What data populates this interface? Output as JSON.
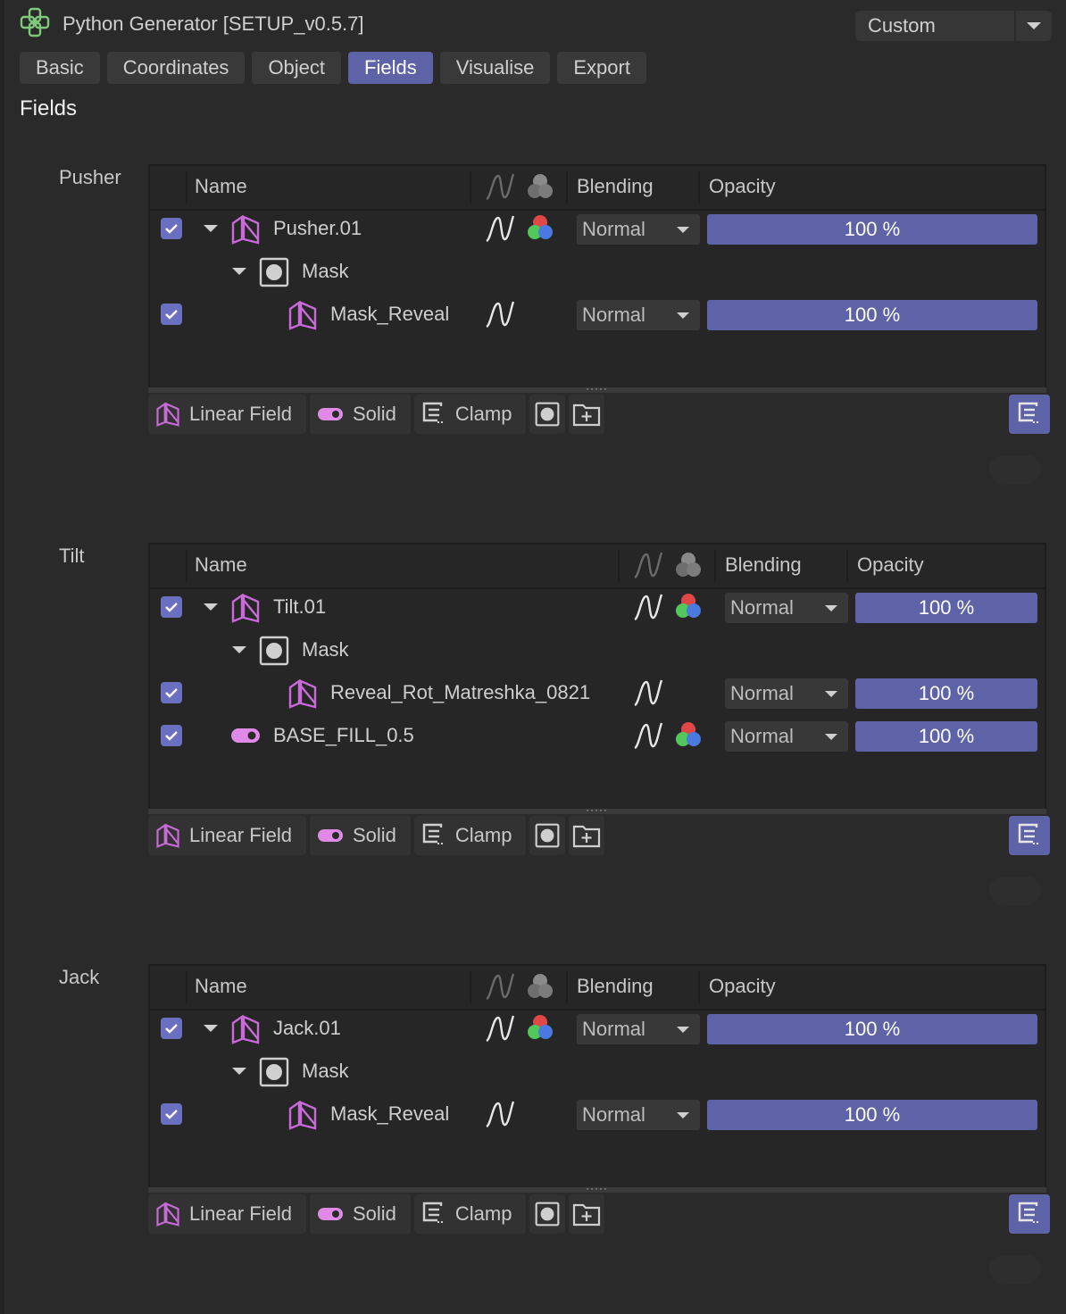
{
  "header": {
    "title": "Python Generator [SETUP_v0.5.7]",
    "preset": "Custom"
  },
  "tabs": [
    "Basic",
    "Coordinates",
    "Object",
    "Fields",
    "Visualise",
    "Export"
  ],
  "active_tab": "Fields",
  "section_title": "Fields",
  "columns": {
    "name": "Name",
    "blending": "Blending",
    "opacity": "Opacity"
  },
  "toolbar": {
    "linear_field": "Linear Field",
    "solid": "Solid",
    "clamp": "Clamp"
  },
  "colors": {
    "accent": "#5e63a8",
    "field_icon": "#c86ad8",
    "solid_icon": "#e08ae8"
  },
  "groups": [
    {
      "label": "Pusher",
      "rows": [
        {
          "name": "Pusher.01",
          "blending": "Normal",
          "opacity": "100 %"
        },
        {
          "name": "Mask"
        },
        {
          "name": "Mask_Reveal",
          "blending": "Normal",
          "opacity": "100 %"
        }
      ]
    },
    {
      "label": "Tilt",
      "rows": [
        {
          "name": "Tilt.01",
          "blending": "Normal",
          "opacity": "100 %"
        },
        {
          "name": "Mask"
        },
        {
          "name": "Reveal_Rot_Matreshka_0821",
          "blending": "Normal",
          "opacity": "100 %"
        },
        {
          "name": "BASE_FILL_0.5",
          "blending": "Normal",
          "opacity": "100 %"
        }
      ]
    },
    {
      "label": "Jack",
      "rows": [
        {
          "name": "Jack.01",
          "blending": "Normal",
          "opacity": "100 %"
        },
        {
          "name": "Mask"
        },
        {
          "name": "Mask_Reveal",
          "blending": "Normal",
          "opacity": "100 %"
        }
      ]
    }
  ]
}
